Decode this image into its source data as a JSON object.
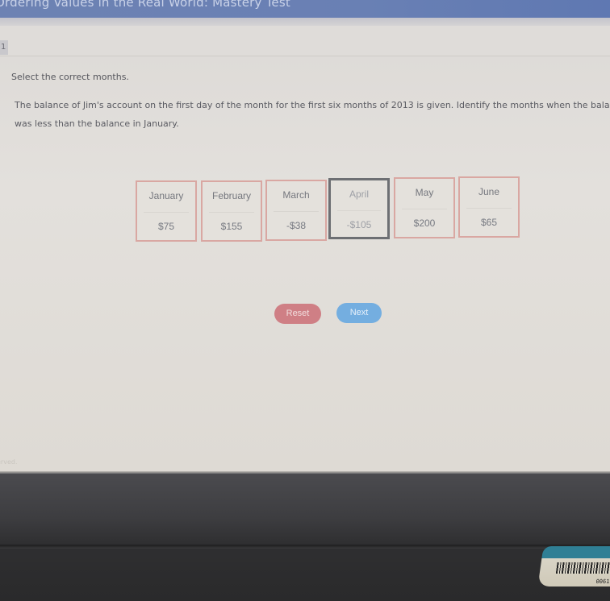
{
  "window": {
    "title": "Ordering Values in the Real World: Mastery Test"
  },
  "question": {
    "number": "1",
    "instruction": "Select the correct months.",
    "text": "The balance of Jim's account on the first day of the month for the first six months of 2013 is given. Identify the months when the balance was less than the balance in January."
  },
  "tiles": [
    {
      "month": "January",
      "value": "$75",
      "selected": false
    },
    {
      "month": "February",
      "value": "$155",
      "selected": false
    },
    {
      "month": "March",
      "value": "-$38",
      "selected": false
    },
    {
      "month": "April",
      "value": "-$105",
      "selected": true
    },
    {
      "month": "May",
      "value": "$200",
      "selected": false
    },
    {
      "month": "June",
      "value": "$65",
      "selected": false
    }
  ],
  "buttons": {
    "reset_label": "Reset",
    "next_label": "Next"
  },
  "footer": {
    "text": "erved."
  },
  "device": {
    "sticker_code": "0061"
  },
  "colors": {
    "title_bar": "#6980b4",
    "tile_border": "#d9a7a2",
    "tile_selected_border": "#6d6f73",
    "reset_button": "#cf7f85",
    "next_button": "#74aee0"
  }
}
